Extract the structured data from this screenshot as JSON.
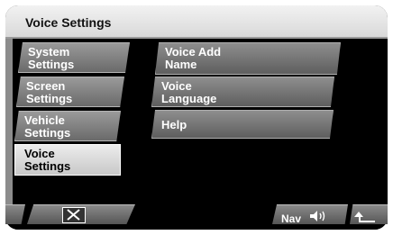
{
  "header": {
    "title": "Voice Settings"
  },
  "sidebar": {
    "items": [
      {
        "label_line1": "System",
        "label_line2": "Settings"
      },
      {
        "label_line1": "Screen",
        "label_line2": "Settings"
      },
      {
        "label_line1": "Vehicle",
        "label_line2": "Settings"
      },
      {
        "label_line1": "Voice",
        "label_line2": "Settings"
      }
    ],
    "active_index": 3
  },
  "menu": {
    "items": [
      {
        "label_line1": "Voice Add",
        "label_line2": "Name"
      },
      {
        "label_line1": "Voice",
        "label_line2": "Language"
      },
      {
        "label_line1": "Help",
        "label_line2": ""
      }
    ]
  },
  "bottom_bar": {
    "close_icon": "close-icon",
    "nav_label": "Nav",
    "speaker_icon": "speaker-icon",
    "back_icon": "back-arrow-icon"
  },
  "colors": {
    "background": "#000000",
    "button_gray": "#7a7a7a",
    "active_button": "#d9d9d9",
    "title_bar": "#e6e6e6"
  }
}
